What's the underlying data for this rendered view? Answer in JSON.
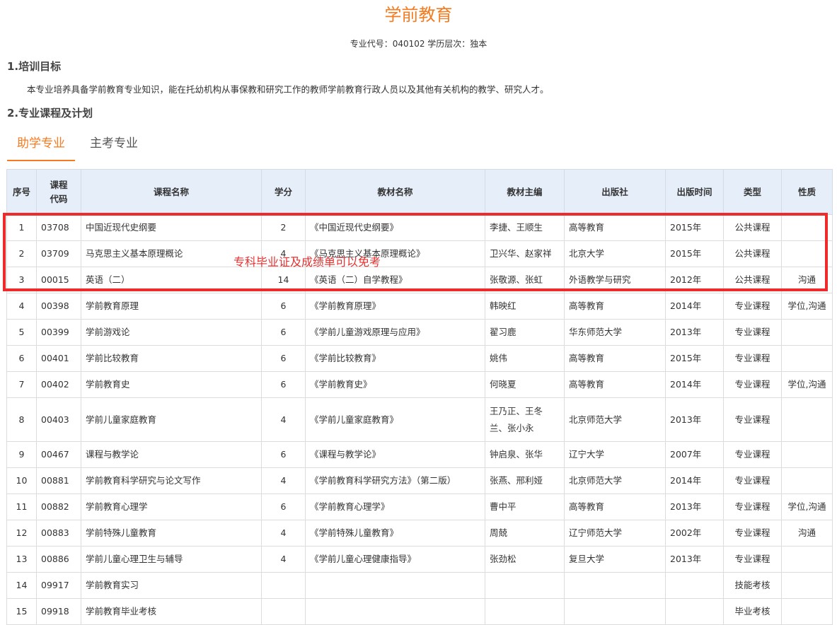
{
  "page": {
    "title": "学前教育",
    "subinfo": "专业代号：040102 学历层次：独本",
    "section1_heading": "1.培训目标",
    "section1_text": "本专业培养具备学前教育专业知识，能在托幼机构从事保教和研究工作的教师学前教育行政人员以及其他有关机构的教学、研究人才。",
    "section2_heading": "2.专业课程及计划"
  },
  "tabs": [
    {
      "label": "助学专业",
      "active": true
    },
    {
      "label": "主考专业",
      "active": false
    }
  ],
  "annotation": {
    "text": "专科毕业证及成绩单可以免考",
    "color": "#e63030"
  },
  "colors": {
    "accent": "#f47b20",
    "header_bg": "#e6eefa",
    "highlight_box": "#ee2a2a"
  },
  "table": {
    "headers": [
      "序号",
      "课程代码",
      "课程名称",
      "学分",
      "教材名称",
      "教材主编",
      "出版社",
      "出版时间",
      "类型",
      "性质"
    ],
    "rows": [
      [
        "1",
        "03708",
        "中国近现代史纲要",
        "2",
        "《中国近现代史纲要》",
        "李捷、王顺生",
        "高等教育",
        "2015年",
        "公共课程",
        ""
      ],
      [
        "2",
        "03709",
        "马克思主义基本原理概论",
        "4",
        "《马克思主义基本原理概论》",
        "卫兴华、赵家祥",
        "北京大学",
        "2015年",
        "公共课程",
        ""
      ],
      [
        "3",
        "00015",
        "英语（二）",
        "14",
        "《英语（二）自学教程》",
        "张敬源、张虹",
        "外语教学与研究",
        "2012年",
        "公共课程",
        "沟通"
      ],
      [
        "4",
        "00398",
        "学前教育原理",
        "6",
        "《学前教育原理》",
        "韩映红",
        "高等教育",
        "2014年",
        "专业课程",
        "学位,沟通"
      ],
      [
        "5",
        "00399",
        "学前游戏论",
        "6",
        "《学前儿童游戏原理与应用》",
        "翟习鹿",
        "华东师范大学",
        "2013年",
        "专业课程",
        ""
      ],
      [
        "6",
        "00401",
        "学前比较教育",
        "6",
        "《学前比较教育》",
        "姚伟",
        "高等教育",
        "2015年",
        "专业课程",
        ""
      ],
      [
        "7",
        "00402",
        "学前教育史",
        "6",
        "《学前教育史》",
        "何晓夏",
        "高等教育",
        "2014年",
        "专业课程",
        "学位,沟通"
      ],
      [
        "8",
        "00403",
        "学前儿童家庭教育",
        "4",
        "《学前儿童家庭教育》",
        "王乃正、王冬兰、张小永",
        "北京师范大学",
        "2013年",
        "专业课程",
        ""
      ],
      [
        "9",
        "00467",
        "课程与教学论",
        "6",
        "《课程与教学论》",
        "钟启泉、张华",
        "辽宁大学",
        "2007年",
        "专业课程",
        ""
      ],
      [
        "10",
        "00881",
        "学前教育科学研究与论文写作",
        "4",
        "《学前教育科学研究方法》（第二版）",
        "张燕、邢利娅",
        "北京师范大学",
        "2014年",
        "专业课程",
        ""
      ],
      [
        "11",
        "00882",
        "学前教育心理学",
        "6",
        "《学前教育心理学》",
        "曹中平",
        "高等教育",
        "2013年",
        "专业课程",
        "学位,沟通"
      ],
      [
        "12",
        "00883",
        "学前特殊儿童教育",
        "4",
        "《学前特殊儿童教育》",
        "周兢",
        "辽宁师范大学",
        "2002年",
        "专业课程",
        "沟通"
      ],
      [
        "13",
        "00886",
        "学前儿童心理卫生与辅导",
        "4",
        "《学前儿童心理健康指导》",
        "张劲松",
        "复旦大学",
        "2013年",
        "专业课程",
        ""
      ],
      [
        "14",
        "09917",
        "学前教育实习",
        "",
        "",
        "",
        "",
        "",
        "技能考核",
        ""
      ],
      [
        "15",
        "09918",
        "学前教育毕业考核",
        "",
        "",
        "",
        "",
        "",
        "毕业考核",
        ""
      ]
    ]
  }
}
